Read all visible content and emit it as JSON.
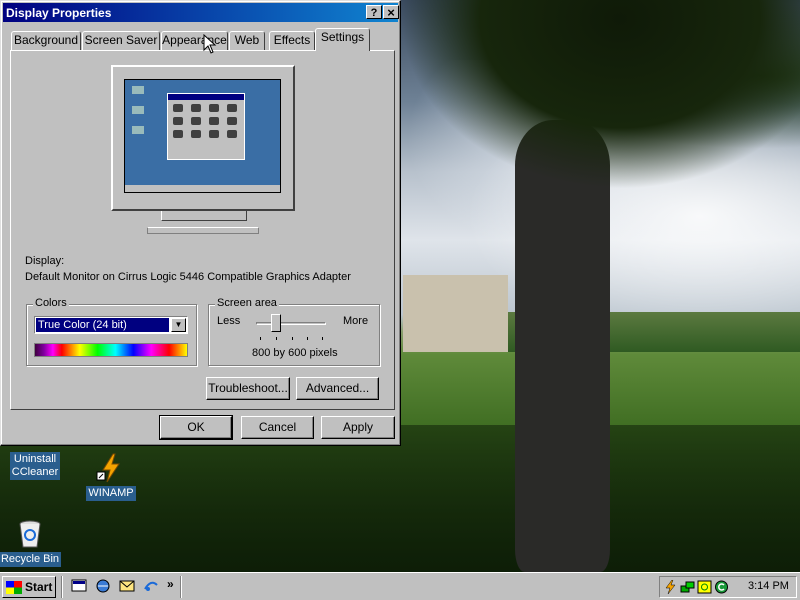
{
  "window": {
    "title": "Display Properties",
    "help_btn": "?",
    "close_btn": "×",
    "tabs": [
      "Background",
      "Screen Saver",
      "Appearance",
      "Web",
      "Effects",
      "Settings"
    ],
    "active_tab": "Settings",
    "display_label": "Display:",
    "display_device": "Default Monitor on Cirrus Logic 5446 Compatible Graphics Adapter",
    "colors": {
      "title": "Colors",
      "selected": "True Color (24 bit)"
    },
    "screen_area": {
      "title": "Screen area",
      "less": "Less",
      "more": "More",
      "value": "800 by 600 pixels",
      "slider_position": 0.25
    },
    "troubleshoot": "Troubleshoot...",
    "advanced": "Advanced...",
    "ok": "OK",
    "cancel": "Cancel",
    "apply": "Apply"
  },
  "desktop": {
    "icons": [
      {
        "label1": "Uninstall",
        "label2": "CCleaner",
        "icon": "ccleaner-icon"
      },
      {
        "label1": "WINAMP",
        "label2": "",
        "icon": "winamp-icon"
      },
      {
        "label1": "Recycle Bin",
        "label2": "",
        "icon": "recycle-bin-icon"
      }
    ]
  },
  "taskbar": {
    "start": "Start",
    "quick_launch_more": "»",
    "clock": "3:14 PM"
  },
  "colors": {
    "titlebar_start": "#000080",
    "titlebar_end": "#1084d0",
    "face": "#c0c0c0",
    "desktop_label_bg": "#2a5e8e"
  }
}
